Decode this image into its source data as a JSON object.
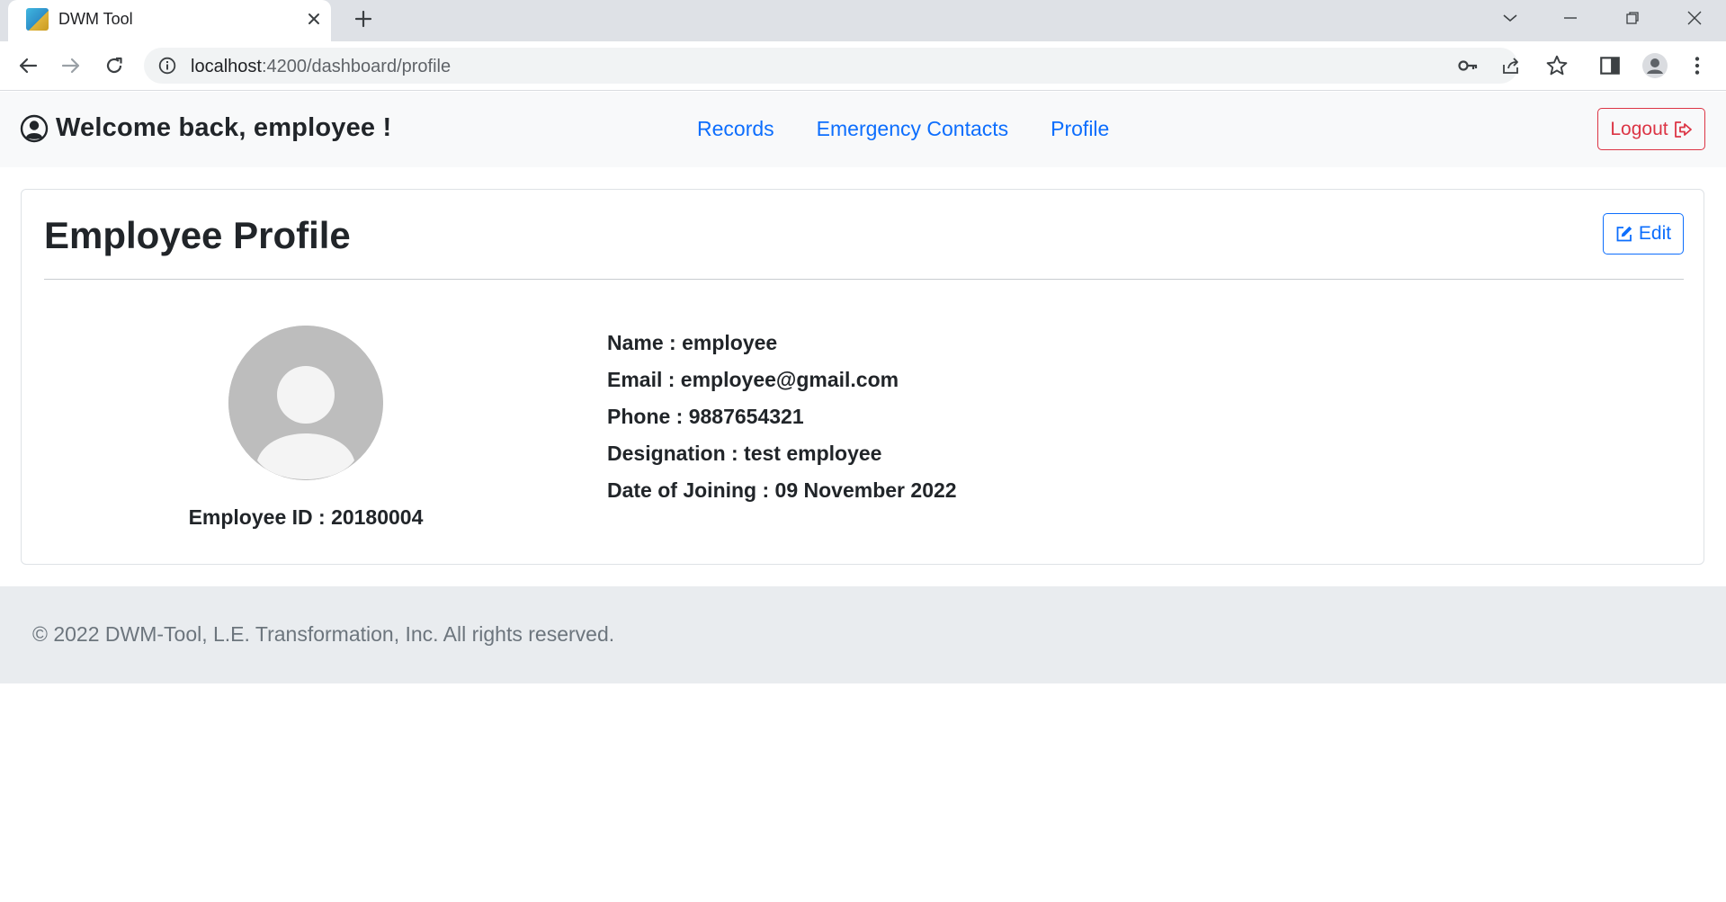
{
  "browser": {
    "tab_title": "DWM Tool",
    "url_host": "localhost",
    "url_rest": ":4200/dashboard/profile"
  },
  "navbar": {
    "welcome": "Welcome back, employee !",
    "links": [
      "Records",
      "Emergency Contacts",
      "Profile"
    ],
    "logout_label": "Logout"
  },
  "profile": {
    "title": "Employee Profile",
    "edit_label": "Edit",
    "employee_id": "Employee ID : 20180004",
    "details": [
      "Name : employee",
      "Email : employee@gmail.com",
      "Phone : 9887654321",
      "Designation : test employee",
      "Date of Joining : 09 November 2022"
    ]
  },
  "footer": {
    "text": "© 2022 DWM-Tool, L.E. Transformation, Inc. All rights reserved."
  },
  "colors": {
    "primary": "#0d6efd",
    "danger": "#dc3545",
    "navbar_bg": "#f8f9fa",
    "footer_bg": "#e9ecef"
  }
}
